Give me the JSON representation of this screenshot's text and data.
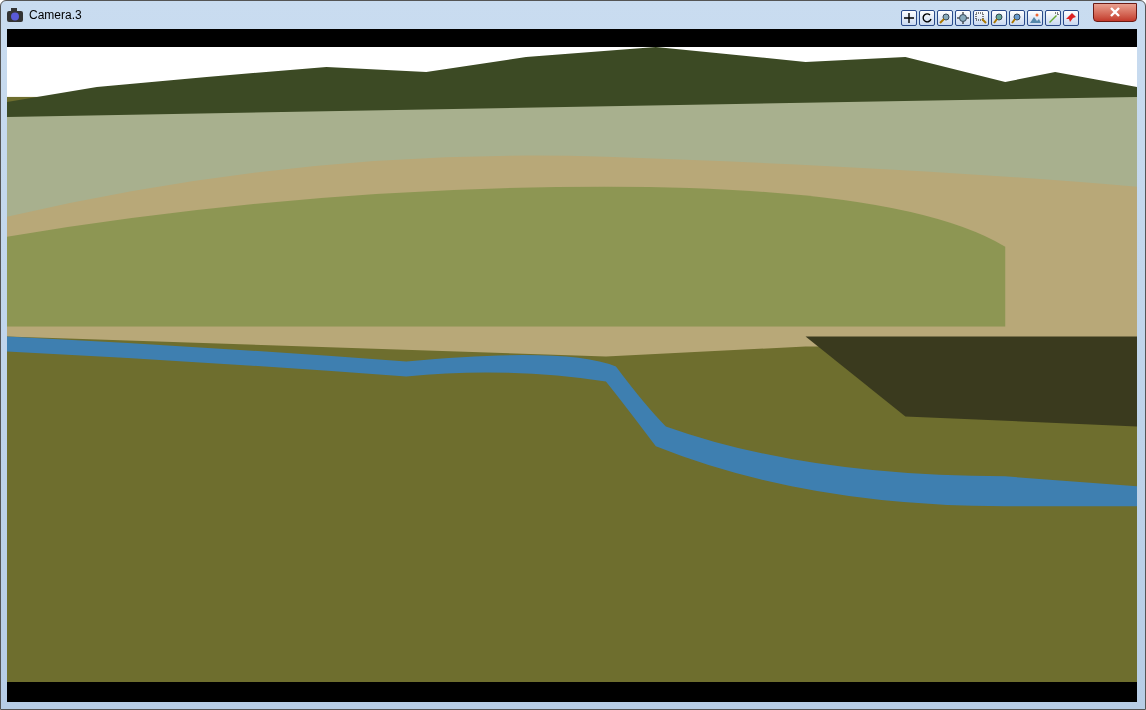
{
  "window": {
    "title": "Camera.3"
  }
}
